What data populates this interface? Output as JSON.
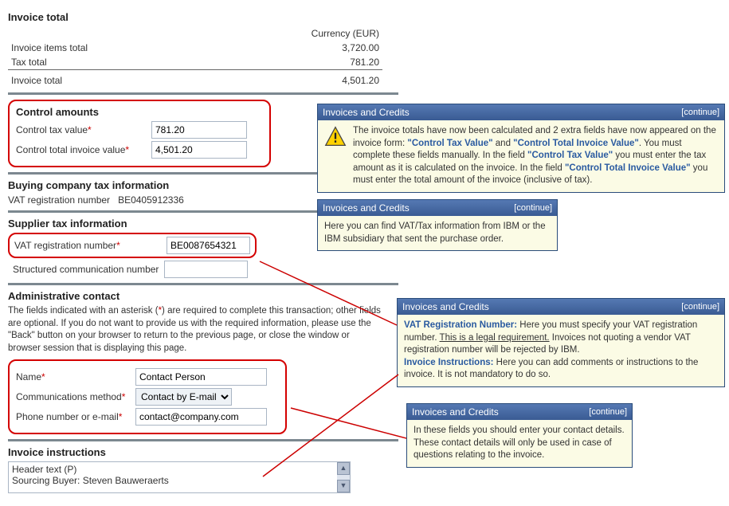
{
  "invoice_total": {
    "title": "Invoice total",
    "currency_label": "Currency (EUR)",
    "rows": [
      {
        "label": "Invoice items total",
        "value": "3,720.00"
      },
      {
        "label": "Tax total",
        "value": "781.20"
      }
    ],
    "total_row": {
      "label": "Invoice total",
      "value": "4,501.20"
    }
  },
  "control": {
    "title": "Control amounts",
    "tax_label": "Control tax value",
    "tax_value": "781.20",
    "total_label": "Control total invoice value",
    "total_value": "4,501.20"
  },
  "buying": {
    "title": "Buying company tax information",
    "vat_label": "VAT registration number",
    "vat_value": "BE0405912336"
  },
  "supplier": {
    "title": "Supplier tax information",
    "vat_label": "VAT registration number",
    "vat_value": "BE0087654321",
    "comm_label": "Structured communication number",
    "comm_value": ""
  },
  "admin": {
    "title": "Administrative contact",
    "help": "The fields indicated with an asterisk (*) are required to complete this transaction; other fields are optional. If you do not want to provide us with the required information, please use the \"Back\" button on your browser to return to the previous page, or close the window or browser session that is displaying this page.",
    "name_label": "Name",
    "name_value": "Contact Person",
    "method_label": "Communications method",
    "method_value": "Contact by E-mail",
    "phone_label": "Phone number or e-mail",
    "phone_value": "contact@company.com"
  },
  "instructions": {
    "title": "Invoice instructions",
    "line1": "Header text (P)",
    "line2": "Sourcing Buyer: Steven Bauweraerts"
  },
  "callouts": {
    "header": "Invoices and Credits",
    "continue": "[continue]",
    "c1_prefix": "The invoice totals have now been calculated and 2 extra fields have now appeared on the invoice form: ",
    "c1_ctv": "\"Control Tax Value\"",
    "c1_and": " and ",
    "c1_ctiv": "\"Control Total Invoice Value\"",
    "c1_mid": ". You must complete these fields manually. In the field ",
    "c1_ctv2": "\"Control Tax Value\"",
    "c1_mid2": " you must enter the tax amount as it is calculated on the invoice. In the field ",
    "c1_ctiv2": "\"Control Total Invoice Value\"",
    "c1_end": " you must enter the total amount of the invoice (inclusive of tax).",
    "c2": "Here you can find VAT/Tax information from IBM or the IBM subsidiary that sent the purchase order.",
    "c3_vat_lbl": "VAT Registration Number:",
    "c3_vat": " Here you must specify your VAT registration number. ",
    "c3_legal": "This is a legal requirement.",
    "c3_vat_end": " Invoices not quoting a vendor VAT registration number will be rejected by IBM.",
    "c3_inv_lbl": "Invoice Instructions:",
    "c3_inv": " Here you can add comments or instructions to the invoice. It is not mandatory to do so.",
    "c4": "In these fields you should enter your contact details. These contact details will only be used in case of questions relating to the invoice."
  }
}
